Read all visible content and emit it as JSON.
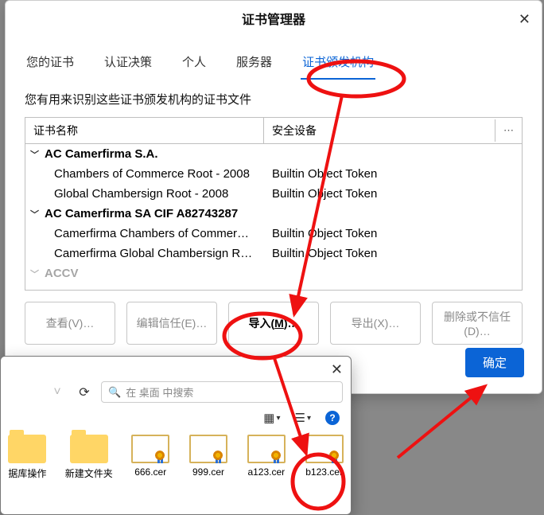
{
  "dialog": {
    "title": "证书管理器",
    "close": "✕",
    "description": "您有用来识别这些证书颁发机构的证书文件",
    "tabs": [
      {
        "label": "您的证书"
      },
      {
        "label": "认证决策"
      },
      {
        "label": "个人"
      },
      {
        "label": "服务器"
      },
      {
        "label": "证书颁发机构",
        "active": true
      }
    ],
    "columns": {
      "name": "证书名称",
      "device": "安全设备",
      "menu": "⋯"
    },
    "groups": [
      {
        "name": "AC Camerfirma S.A.",
        "rows": [
          {
            "name": "Chambers of Commerce Root - 2008",
            "device": "Builtin Object Token"
          },
          {
            "name": "Global Chambersign Root - 2008",
            "device": "Builtin Object Token"
          }
        ]
      },
      {
        "name": "AC Camerfirma SA CIF A82743287",
        "rows": [
          {
            "name": "Camerfirma Chambers of Commer…",
            "device": "Builtin Object Token"
          },
          {
            "name": "Camerfirma Global Chambersign R…",
            "device": "Builtin Object Token"
          }
        ]
      },
      {
        "name": "ACCV",
        "rows": []
      }
    ],
    "buttons": {
      "view": "查看(V)…",
      "edit_trust": "编辑信任(E)…",
      "import_prefix": "导入(",
      "import_key": "M",
      "import_suffix": ")…",
      "export": "导出(X)…",
      "delete": "删除或不信任(D)…",
      "ok": "确定"
    }
  },
  "filepicker": {
    "close": "✕",
    "search_placeholder": "在 桌面 中搜索",
    "toolbar": {
      "organize_icon": "☰",
      "view_icon": "▭",
      "help": "?"
    },
    "files": [
      {
        "kind": "folder",
        "label": "据库操作"
      },
      {
        "kind": "folder",
        "label": "新建文件夹"
      },
      {
        "kind": "cert",
        "label": "666.cer"
      },
      {
        "kind": "cert",
        "label": "999.cer"
      },
      {
        "kind": "cert",
        "label": "a123.cer"
      },
      {
        "kind": "cert",
        "label": "b123.cer"
      }
    ]
  }
}
